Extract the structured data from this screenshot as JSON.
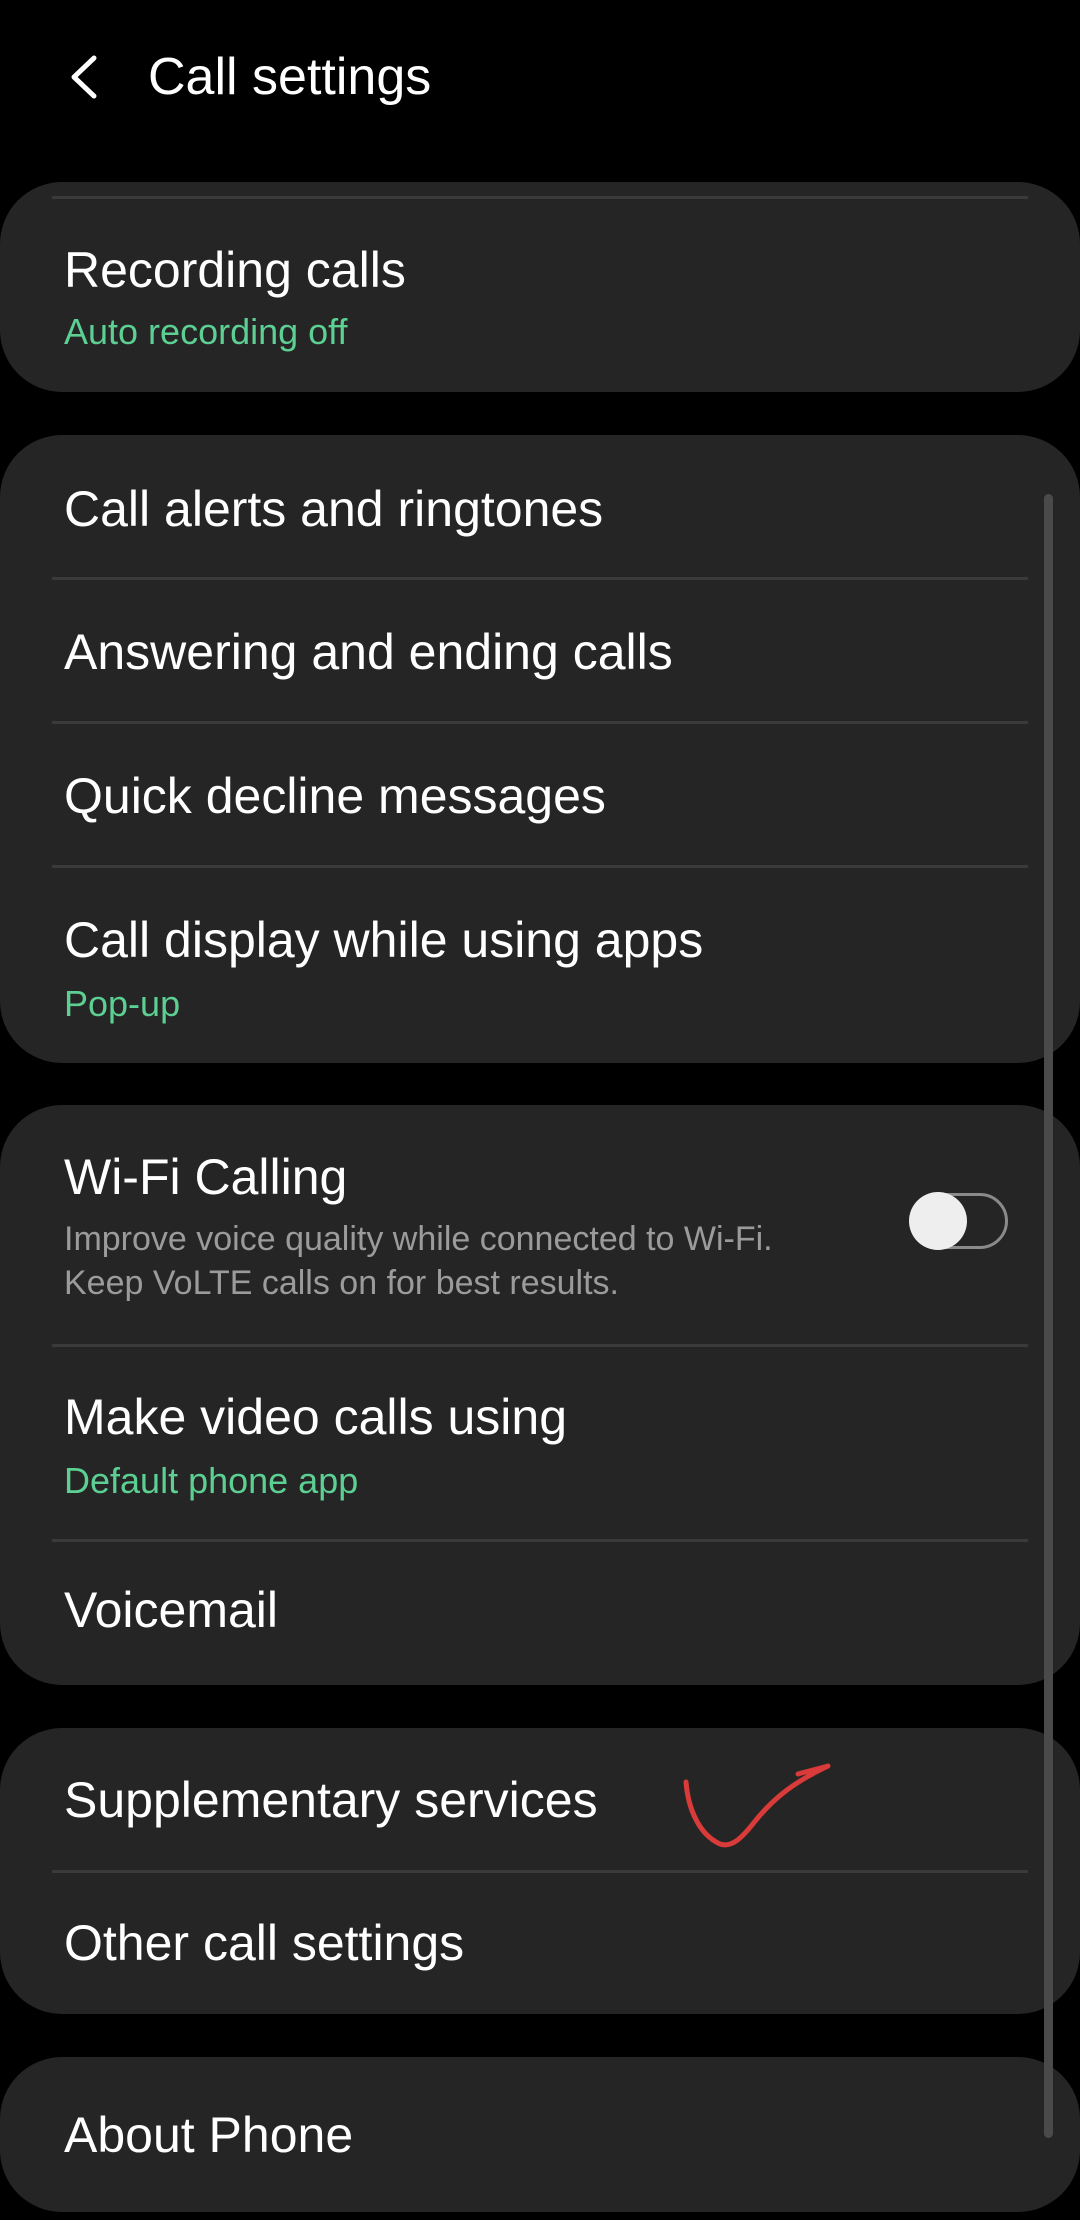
{
  "header": {
    "back_icon": "chevron-left-icon",
    "title": "Call settings"
  },
  "groups": [
    {
      "items": [
        {
          "title": "Recording calls",
          "subtitle": "Auto recording off"
        }
      ]
    },
    {
      "items": [
        {
          "title": "Call alerts and ringtones"
        },
        {
          "title": "Answering and ending calls"
        },
        {
          "title": "Quick decline messages"
        },
        {
          "title": "Call display while using apps",
          "subtitle": "Pop-up"
        }
      ]
    },
    {
      "items": [
        {
          "title": "Wi-Fi Calling",
          "description_line1": "Improve voice quality while connected to Wi-Fi.",
          "description_line2": "Keep VoLTE calls on for best results.",
          "toggle_state": "off"
        },
        {
          "title": "Make video calls using",
          "subtitle": "Default phone app"
        },
        {
          "title": "Voicemail"
        }
      ]
    },
    {
      "items": [
        {
          "title": "Supplementary services",
          "annotation": "red-checkmark-icon"
        },
        {
          "title": "Other call settings"
        }
      ]
    },
    {
      "items": [
        {
          "title": "About Phone"
        }
      ]
    }
  ],
  "colors": {
    "background": "#000000",
    "card": "#252525",
    "accent_subtitle": "#5ccf92",
    "annotation": "#d93a3a"
  }
}
